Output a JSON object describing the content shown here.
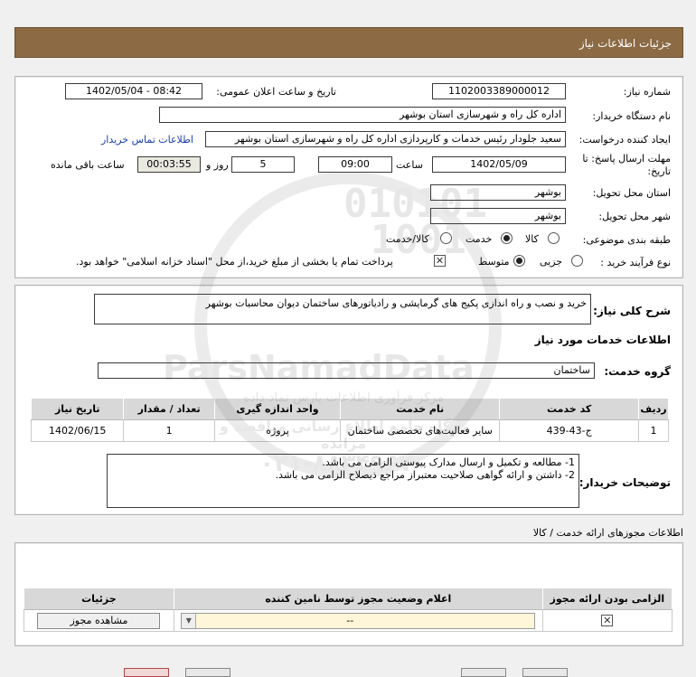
{
  "header": {
    "title": "جزئیات اطلاعات نیاز"
  },
  "fields": {
    "need_number_label": "شماره نیاز:",
    "need_number": "1102003389000012",
    "announce_label": "تاریخ و ساعت اعلان عمومی:",
    "announce_value": "1402/05/04 - 08:42",
    "buyer_org_label": "نام دستگاه خریدار:",
    "buyer_org": "اداره کل راه و شهرسازی استان بوشهر",
    "creator_label": "ایجاد کننده درخواست:",
    "creator": "سعید جلودار رئیس خدمات و کارپردازی اداره کل راه و شهرسازی استان بوشهر",
    "contact_link": "اطلاعات تماس خریدار",
    "deadline_label_1": "مهلت ارسال پاسخ: تا",
    "deadline_label_2": "تاریخ:",
    "deadline_date": "1402/05/09",
    "time_label": "ساعت",
    "deadline_time": "09:00",
    "days_value": "5",
    "days_label": "روز و",
    "remaining_time": "00:03:55",
    "remaining_label": "ساعت باقی مانده",
    "province_label": "استان محل تحویل:",
    "province": "بوشهر",
    "city_label": "شهر محل تحویل:",
    "city": "بوشهر",
    "category_label": "طبقه بندی موضوعی:",
    "category_options": [
      "کالا",
      "خدمت",
      "کالا/خدمت"
    ],
    "category_selected": "خدمت",
    "process_label": "نوع فرآیند خرید :",
    "process_options": [
      "جزیی",
      "متوسط"
    ],
    "process_selected": "متوسط",
    "treasury_text": "پرداخت تمام یا بخشی از مبلغ خرید،از محل \"اسناد خزانه اسلامی\" خواهد بود."
  },
  "summary": {
    "label": "شرح کلی نیاز:",
    "text": "خرید و نصب و راه اندازی پکیج های گرمایشی و رادیاتورهای ساختمان دیوان محاسبات بوشهر",
    "services_heading": "اطلاعات خدمات مورد نیاز",
    "service_group_label": "گروه خدمت:",
    "service_group": "ساختمان"
  },
  "table": {
    "headers": [
      "ردیف",
      "کد خدمت",
      "نام خدمت",
      "واحد اندازه گیری",
      "تعداد / مقدار",
      "تاریخ نیاز"
    ],
    "rows": [
      [
        "1",
        "ج-43-439",
        "سایر فعالیت‌های تخصصی ساختمان",
        "پروژه",
        "1",
        "1402/06/15"
      ]
    ]
  },
  "notes": {
    "label": "توضیحات خریدار:",
    "lines": [
      "1- مطالعه و تکمیل و ارسال مدارک پیوستی الزامی می باشد.",
      "2- داشتن و ارائه گواهی صلاحیت معتبراز مراجع ذیصلاح الزامی می باشد."
    ]
  },
  "permits": {
    "title": "اطلاعات مجوزهای ارائه خدمت / کالا",
    "headers": [
      "الزامی بودن ارائه مجوز",
      "اعلام وضعیت مجوز توسط نامین کننده",
      "جزئیات"
    ],
    "select_value": "--",
    "view_button": "مشاهده مجوز"
  },
  "watermark": {
    "digits_1": "010101",
    "digits_2": "1001",
    "brand": "ParsNamadData",
    "tagline_1": "مرکز فرآوری اطلاعات پارس نماد داده",
    "tagline_2": "پایگاه جامع اطلاع رسانی مناقصه و مزایده",
    "phone": "۰۲۱-۸۸۳۴۹۶۷۰"
  },
  "colors": {
    "header_bg": "#8b6a44",
    "link": "#1a3fa8"
  }
}
